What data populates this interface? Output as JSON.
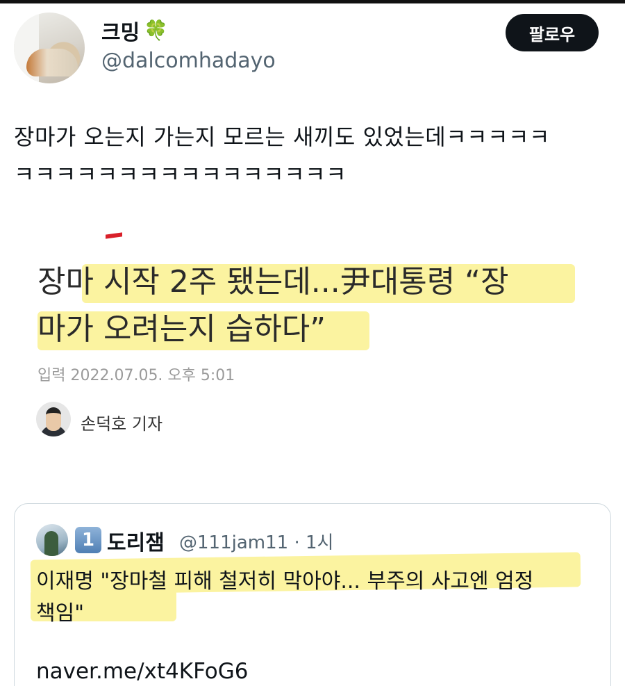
{
  "header": {
    "display_name": "크밍",
    "handle": "@dalcomhadayo",
    "follow_label": "팔로우",
    "name_emoji": "🍀"
  },
  "tweet": {
    "lines": [
      "장마가 오는지 가는지 모르는 새끼도 있었는데ㅋㅋㅋㅋㅋ",
      "ㅋㅋㅋㅋㅋㅋㅋㅋㅋㅋㅋㅋㅋㅋㅋㅋ"
    ]
  },
  "article": {
    "headline_lines": [
      "장마 시작 2주 됐는데...尹대통령 “장",
      "마가 오려는지 습하다”"
    ],
    "date": "입력 2022.07.05. 오후 5:01",
    "reporter": "손덕호 기자",
    "highlight_color": "#fbf3a0",
    "accent_color": "#d9202a"
  },
  "quoted_tweet": {
    "badge": "1",
    "name": "도리잼",
    "handle_time": "@111jam11 · 1시",
    "text_lines": [
      "이재명 \"장마철 피해 철저히 막아야... 부주의 사고엔 엄정",
      "책임\""
    ],
    "link": "naver.me/xt4KFoG6"
  },
  "colors": {
    "text_primary": "#0f1419",
    "text_secondary": "#536471",
    "follow_bg": "#0f1419",
    "card_border": "#cfd9de"
  }
}
